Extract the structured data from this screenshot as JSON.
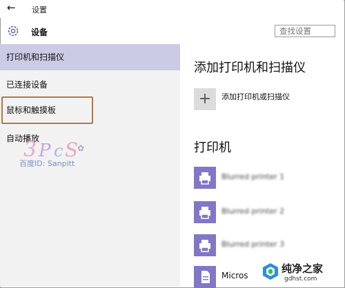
{
  "window": {
    "title": "设置"
  },
  "header": {
    "section": "设备",
    "search_placeholder": "查找设置"
  },
  "sidebar": {
    "items": [
      {
        "label": "打印机和扫描仪",
        "active": true
      },
      {
        "label": "已连接设备",
        "active": false
      },
      {
        "label": "鼠标和触摸板",
        "active": false,
        "highlighted": true
      },
      {
        "label": "自动播放",
        "active": false
      }
    ]
  },
  "watermark": {
    "text": "百度ID: Sanpitt"
  },
  "main": {
    "title": "添加打印机和扫描仪",
    "add_label": "添加打印机或扫描仪",
    "printers_title": "打印机",
    "devices": [
      {
        "name": "Blurred printer 1"
      },
      {
        "name": "Blurred printer 2"
      },
      {
        "name": "Blurred printer 3"
      },
      {
        "name": "Micros"
      }
    ]
  },
  "branding": {
    "name": "纯净之家",
    "url": "gdhst.com"
  },
  "colors": {
    "active_item": "#cccbe6",
    "device_icon": "#8177c7",
    "highlight_box": "#b07845"
  }
}
